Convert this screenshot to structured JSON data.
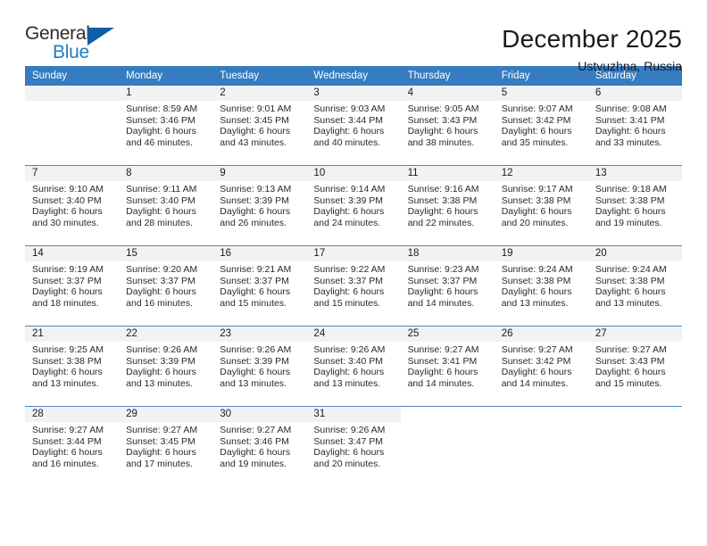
{
  "brand": {
    "name_part1": "General",
    "name_part2": "Blue",
    "flag_icon": "triangle-flag-icon"
  },
  "header": {
    "title": "December 2025",
    "subtitle": "Ustyuzhna, Russia"
  },
  "colors": {
    "header_blue": "#357dc0",
    "row_divider": "#4a86c5",
    "daynum_band": "#f2f2f2",
    "brand_blue": "#1f7dc4",
    "brand_flag": "#0e5fa8"
  },
  "labels": {
    "sunrise_prefix": "Sunrise:",
    "sunset_prefix": "Sunset:",
    "daylight_prefix": "Daylight:"
  },
  "weekdays": [
    "Sunday",
    "Monday",
    "Tuesday",
    "Wednesday",
    "Thursday",
    "Friday",
    "Saturday"
  ],
  "weeks": [
    [
      {
        "day": "",
        "sunrise": "",
        "sunset": "",
        "daylight_line1": "",
        "daylight_line2": "",
        "empty": true
      },
      {
        "day": "1",
        "sunrise": "Sunrise: 8:59 AM",
        "sunset": "Sunset: 3:46 PM",
        "daylight_line1": "Daylight: 6 hours",
        "daylight_line2": "and 46 minutes."
      },
      {
        "day": "2",
        "sunrise": "Sunrise: 9:01 AM",
        "sunset": "Sunset: 3:45 PM",
        "daylight_line1": "Daylight: 6 hours",
        "daylight_line2": "and 43 minutes."
      },
      {
        "day": "3",
        "sunrise": "Sunrise: 9:03 AM",
        "sunset": "Sunset: 3:44 PM",
        "daylight_line1": "Daylight: 6 hours",
        "daylight_line2": "and 40 minutes."
      },
      {
        "day": "4",
        "sunrise": "Sunrise: 9:05 AM",
        "sunset": "Sunset: 3:43 PM",
        "daylight_line1": "Daylight: 6 hours",
        "daylight_line2": "and 38 minutes."
      },
      {
        "day": "5",
        "sunrise": "Sunrise: 9:07 AM",
        "sunset": "Sunset: 3:42 PM",
        "daylight_line1": "Daylight: 6 hours",
        "daylight_line2": "and 35 minutes."
      },
      {
        "day": "6",
        "sunrise": "Sunrise: 9:08 AM",
        "sunset": "Sunset: 3:41 PM",
        "daylight_line1": "Daylight: 6 hours",
        "daylight_line2": "and 33 minutes."
      }
    ],
    [
      {
        "day": "7",
        "sunrise": "Sunrise: 9:10 AM",
        "sunset": "Sunset: 3:40 PM",
        "daylight_line1": "Daylight: 6 hours",
        "daylight_line2": "and 30 minutes."
      },
      {
        "day": "8",
        "sunrise": "Sunrise: 9:11 AM",
        "sunset": "Sunset: 3:40 PM",
        "daylight_line1": "Daylight: 6 hours",
        "daylight_line2": "and 28 minutes."
      },
      {
        "day": "9",
        "sunrise": "Sunrise: 9:13 AM",
        "sunset": "Sunset: 3:39 PM",
        "daylight_line1": "Daylight: 6 hours",
        "daylight_line2": "and 26 minutes."
      },
      {
        "day": "10",
        "sunrise": "Sunrise: 9:14 AM",
        "sunset": "Sunset: 3:39 PM",
        "daylight_line1": "Daylight: 6 hours",
        "daylight_line2": "and 24 minutes."
      },
      {
        "day": "11",
        "sunrise": "Sunrise: 9:16 AM",
        "sunset": "Sunset: 3:38 PM",
        "daylight_line1": "Daylight: 6 hours",
        "daylight_line2": "and 22 minutes."
      },
      {
        "day": "12",
        "sunrise": "Sunrise: 9:17 AM",
        "sunset": "Sunset: 3:38 PM",
        "daylight_line1": "Daylight: 6 hours",
        "daylight_line2": "and 20 minutes."
      },
      {
        "day": "13",
        "sunrise": "Sunrise: 9:18 AM",
        "sunset": "Sunset: 3:38 PM",
        "daylight_line1": "Daylight: 6 hours",
        "daylight_line2": "and 19 minutes."
      }
    ],
    [
      {
        "day": "14",
        "sunrise": "Sunrise: 9:19 AM",
        "sunset": "Sunset: 3:37 PM",
        "daylight_line1": "Daylight: 6 hours",
        "daylight_line2": "and 18 minutes."
      },
      {
        "day": "15",
        "sunrise": "Sunrise: 9:20 AM",
        "sunset": "Sunset: 3:37 PM",
        "daylight_line1": "Daylight: 6 hours",
        "daylight_line2": "and 16 minutes."
      },
      {
        "day": "16",
        "sunrise": "Sunrise: 9:21 AM",
        "sunset": "Sunset: 3:37 PM",
        "daylight_line1": "Daylight: 6 hours",
        "daylight_line2": "and 15 minutes."
      },
      {
        "day": "17",
        "sunrise": "Sunrise: 9:22 AM",
        "sunset": "Sunset: 3:37 PM",
        "daylight_line1": "Daylight: 6 hours",
        "daylight_line2": "and 15 minutes."
      },
      {
        "day": "18",
        "sunrise": "Sunrise: 9:23 AM",
        "sunset": "Sunset: 3:37 PM",
        "daylight_line1": "Daylight: 6 hours",
        "daylight_line2": "and 14 minutes."
      },
      {
        "day": "19",
        "sunrise": "Sunrise: 9:24 AM",
        "sunset": "Sunset: 3:38 PM",
        "daylight_line1": "Daylight: 6 hours",
        "daylight_line2": "and 13 minutes."
      },
      {
        "day": "20",
        "sunrise": "Sunrise: 9:24 AM",
        "sunset": "Sunset: 3:38 PM",
        "daylight_line1": "Daylight: 6 hours",
        "daylight_line2": "and 13 minutes."
      }
    ],
    [
      {
        "day": "21",
        "sunrise": "Sunrise: 9:25 AM",
        "sunset": "Sunset: 3:38 PM",
        "daylight_line1": "Daylight: 6 hours",
        "daylight_line2": "and 13 minutes."
      },
      {
        "day": "22",
        "sunrise": "Sunrise: 9:26 AM",
        "sunset": "Sunset: 3:39 PM",
        "daylight_line1": "Daylight: 6 hours",
        "daylight_line2": "and 13 minutes."
      },
      {
        "day": "23",
        "sunrise": "Sunrise: 9:26 AM",
        "sunset": "Sunset: 3:39 PM",
        "daylight_line1": "Daylight: 6 hours",
        "daylight_line2": "and 13 minutes."
      },
      {
        "day": "24",
        "sunrise": "Sunrise: 9:26 AM",
        "sunset": "Sunset: 3:40 PM",
        "daylight_line1": "Daylight: 6 hours",
        "daylight_line2": "and 13 minutes."
      },
      {
        "day": "25",
        "sunrise": "Sunrise: 9:27 AM",
        "sunset": "Sunset: 3:41 PM",
        "daylight_line1": "Daylight: 6 hours",
        "daylight_line2": "and 14 minutes."
      },
      {
        "day": "26",
        "sunrise": "Sunrise: 9:27 AM",
        "sunset": "Sunset: 3:42 PM",
        "daylight_line1": "Daylight: 6 hours",
        "daylight_line2": "and 14 minutes."
      },
      {
        "day": "27",
        "sunrise": "Sunrise: 9:27 AM",
        "sunset": "Sunset: 3:43 PM",
        "daylight_line1": "Daylight: 6 hours",
        "daylight_line2": "and 15 minutes."
      }
    ],
    [
      {
        "day": "28",
        "sunrise": "Sunrise: 9:27 AM",
        "sunset": "Sunset: 3:44 PM",
        "daylight_line1": "Daylight: 6 hours",
        "daylight_line2": "and 16 minutes."
      },
      {
        "day": "29",
        "sunrise": "Sunrise: 9:27 AM",
        "sunset": "Sunset: 3:45 PM",
        "daylight_line1": "Daylight: 6 hours",
        "daylight_line2": "and 17 minutes."
      },
      {
        "day": "30",
        "sunrise": "Sunrise: 9:27 AM",
        "sunset": "Sunset: 3:46 PM",
        "daylight_line1": "Daylight: 6 hours",
        "daylight_line2": "and 19 minutes."
      },
      {
        "day": "31",
        "sunrise": "Sunrise: 9:26 AM",
        "sunset": "Sunset: 3:47 PM",
        "daylight_line1": "Daylight: 6 hours",
        "daylight_line2": "and 20 minutes."
      },
      {
        "day": "",
        "sunrise": "",
        "sunset": "",
        "daylight_line1": "",
        "daylight_line2": "",
        "blank": true
      },
      {
        "day": "",
        "sunrise": "",
        "sunset": "",
        "daylight_line1": "",
        "daylight_line2": "",
        "blank": true
      },
      {
        "day": "",
        "sunrise": "",
        "sunset": "",
        "daylight_line1": "",
        "daylight_line2": "",
        "blank": true
      }
    ]
  ]
}
